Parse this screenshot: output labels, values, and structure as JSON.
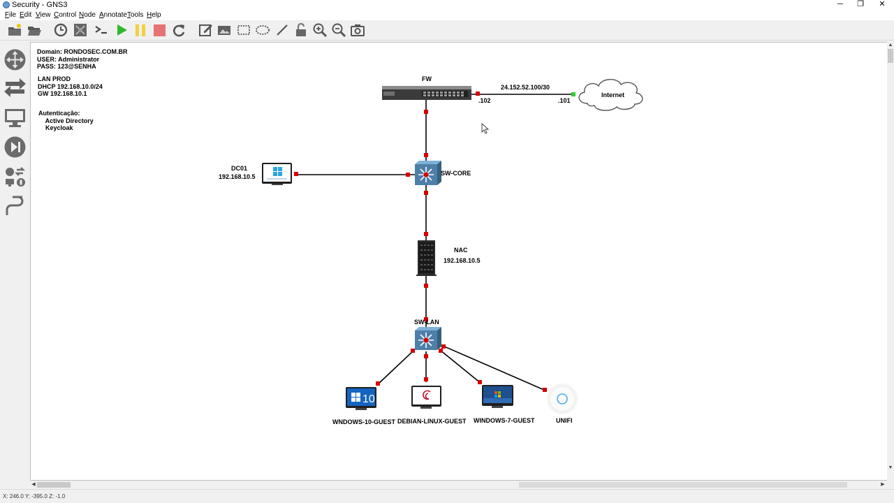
{
  "window": {
    "title": "Security - GNS3",
    "minimize": "─",
    "maximize": "❐",
    "close": "✕"
  },
  "menubar": [
    "File",
    "Edit",
    "View",
    "Control",
    "Node",
    "Annotate",
    "Tools",
    "Help"
  ],
  "toolbar": {
    "buttons": [
      "new-project-icon",
      "open-project-icon",
      "snapshot-icon",
      "show-interface-labels-icon",
      "console-all-icon",
      "start-all-icon",
      "suspend-all-icon",
      "stop-all-icon",
      "reload-all-icon",
      "add-note-icon",
      "insert-picture-icon",
      "draw-rectangle-icon",
      "draw-ellipse-icon",
      "draw-line-icon",
      "lock-icon",
      "zoom-in-icon",
      "zoom-out-icon",
      "screenshot-icon"
    ]
  },
  "dock": [
    "routers-icon",
    "switches-icon",
    "end-devices-icon",
    "security-devices-icon",
    "all-devices-icon",
    "add-link-icon"
  ],
  "notes": {
    "domain": "Domain: RONDOSEC.COM.BR\nUSER: Administrator\nPASS: 123@SENHA",
    "lan": "LAN PROD\nDHCP 192.168.10.0/24\nGW 192.168.10.1",
    "auth": "Autenticação:\n    Active Directory\n    Keycloak"
  },
  "nodes": {
    "fw": "FW",
    "internet": "Internet",
    "sw_core": "SW-CORE",
    "dc01_name": "DC01",
    "dc01_ip": "192.168.10.5",
    "nac_name": "NAC",
    "nac_ip": "192.168.10.5",
    "sw_lan": "SW-LAN",
    "win10": "WNDOWS-10-GUEST",
    "debian": "DEBIAN-LINUX-GUEST",
    "win7": "WINDOWS-7-GUEST",
    "unifi": "UNIFI"
  },
  "links": {
    "wan_subnet": "24.152.52.100/30",
    "fw_wan_ip": ".102",
    "isp_ip": ".101"
  },
  "colors": {
    "link_up_port": "#d40000",
    "link_green_port": "#33cc33",
    "link_line": "#000000",
    "start_green": "#2eb82e",
    "suspend_yellow": "#f4d03f",
    "stop_red": "#e57373"
  },
  "statusbar": {
    "coords": "X: 246.0 Y: -395.0 Z: -1.0"
  }
}
